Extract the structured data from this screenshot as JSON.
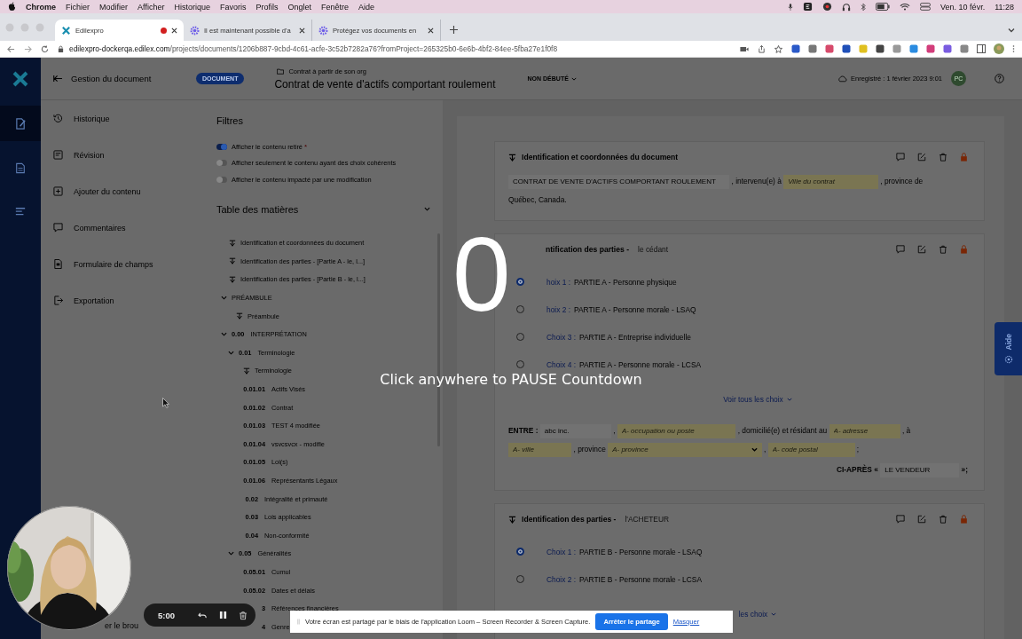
{
  "menu_bar": {
    "app": "Chrome",
    "items": [
      "Fichier",
      "Modifier",
      "Afficher",
      "Historique",
      "Favoris",
      "Profils",
      "Onglet",
      "Fenêtre",
      "Aide"
    ],
    "date": "Ven. 10 févr.",
    "time": "11:28"
  },
  "browser": {
    "tabs": [
      {
        "title": "Edilexpro",
        "selected": true,
        "recording": true
      },
      {
        "title": "Il est maintenant possible d'a",
        "selected": false,
        "recording": false
      },
      {
        "title": "Protégez vos documents en",
        "selected": false,
        "recording": false
      }
    ],
    "url_host": "edilexpro-dockerqa.edilex.com",
    "url_path": "/projects/documents/1206b887-9cbd-4c61-acfe-3c52b7282a76?fromProject=265325b0-6e6b-4bf2-84ee-5fba27e1f0f8"
  },
  "rail": [
    {
      "kind": "edit",
      "selected": true
    },
    {
      "kind": "document",
      "selected": false
    },
    {
      "kind": "list",
      "selected": false
    }
  ],
  "header": {
    "back_label": "Gestion du document",
    "badge": "DOCUMENT",
    "breadcrumb": "Contrat à partir de son org",
    "title": "Contrat de vente d'actifs comportant roulement",
    "status": "NON DÉBUTÉ",
    "saved": "Enregistré : 1 février 2023 9:01",
    "avatar": "PC"
  },
  "side_menu": [
    {
      "kind": "history",
      "label": "Historique"
    },
    {
      "kind": "revision",
      "label": "Révision"
    },
    {
      "kind": "add",
      "label": "Ajouter du contenu"
    },
    {
      "kind": "comments",
      "label": "Commentaires"
    },
    {
      "kind": "form",
      "label": "Formulaire de champs"
    },
    {
      "kind": "export",
      "label": "Exportation"
    }
  ],
  "side_menu_footer": "er le brou",
  "filters": {
    "title": "Filtres",
    "options": [
      {
        "label": "Afficher le contenu retiré",
        "on": true,
        "flag": "*"
      },
      {
        "label": "Afficher seulement le contenu ayant des choix cohérents",
        "on": false
      },
      {
        "label": "Afficher le contenu impacté par une modification",
        "on": false
      }
    ]
  },
  "toc": {
    "title": "Table des matières",
    "expanded": true,
    "items": [
      {
        "kind": "section",
        "label": "Identification et coordonnées du document"
      },
      {
        "kind": "section",
        "label": "Identification des parties - [Partie A - le, l...]"
      },
      {
        "kind": "section",
        "label": "Identification des parties - [Partie B - le, l...]"
      },
      {
        "kind": "heading",
        "label": "PRÉAMBULE",
        "expanded": true,
        "children": [
          {
            "kind": "section",
            "label": "Préambule"
          }
        ]
      },
      {
        "kind": "heading",
        "number": "0.00",
        "label": "INTERPRÉTATION",
        "expanded": true,
        "children": [
          {
            "kind": "heading",
            "number": "0.01",
            "label": "Terminologie",
            "expanded": true,
            "children": [
              {
                "kind": "section",
                "label": "Terminologie"
              },
              {
                "kind": "entry",
                "number": "0.01.01",
                "label": "Actifs Visés"
              },
              {
                "kind": "entry",
                "number": "0.01.02",
                "label": "Contrat"
              },
              {
                "kind": "entry",
                "number": "0.01.03",
                "label": "TEST 4 modifiée"
              },
              {
                "kind": "entry",
                "number": "0.01.04",
                "label": "vsvcsvcx - modifie"
              },
              {
                "kind": "entry",
                "number": "0.01.05",
                "label": "Loi(s)"
              },
              {
                "kind": "entry",
                "number": "0.01.06",
                "label": "Représentants Légaux"
              }
            ]
          },
          {
            "kind": "entry",
            "number": "0.02",
            "label": "Intégralité et primauté"
          },
          {
            "kind": "entry",
            "number": "0.03",
            "label": "Lois applicables"
          },
          {
            "kind": "entry",
            "number": "0.04",
            "label": "Non-conformité"
          },
          {
            "kind": "heading",
            "number": "0.05",
            "label": "Généralités",
            "expanded": true,
            "children": [
              {
                "kind": "entry",
                "number": "0.05.01",
                "label": "Cumul"
              },
              {
                "kind": "entry",
                "number": "0.05.02",
                "label": "Dates et délais"
              },
              {
                "kind": "entry",
                "number": "3",
                "label": "Références financières"
              },
              {
                "kind": "entry",
                "number": "4",
                "label": "Genre"
              }
            ]
          }
        ]
      }
    ]
  },
  "document": {
    "cards": [
      {
        "icon": true,
        "title": "Identification et coordonnées du document",
        "lines": [
          {
            "right": false,
            "segments": [
              {
                "kind": "value",
                "text": "CONTRAT DE VENTE D'ACTIFS COMPORTANT ROULEMENT"
              },
              {
                "kind": "text",
                "text": ", intervenu(e) à"
              },
              {
                "kind": "blank",
                "placeholder": "Ville du contrat"
              },
              {
                "kind": "text",
                "text": ", province de"
              },
              {
                "kind": "text",
                "text": "Québec, Canada."
              }
            ]
          }
        ]
      },
      {
        "icon": false,
        "title": "ntification des parties -",
        "subtitle": "le cédant",
        "choices": [
          {
            "label": "hoix 1 :",
            "text": "PARTIE A - Personne physique",
            "selected": true
          },
          {
            "label": "hoix 2 :",
            "text": "PARTIE A - Personne morale - LSAQ",
            "selected": false
          },
          {
            "label": "Choix 3 :",
            "text": "PARTIE A - Entreprise individuelle",
            "selected": false
          },
          {
            "label": "Choix 4 :",
            "text": "PARTIE A - Personne morale - LCSA",
            "selected": false
          }
        ],
        "more": "Voir tous les choix",
        "lines": [
          {
            "right": false,
            "segments": [
              {
                "kind": "label",
                "text": "ENTRE :"
              },
              {
                "kind": "value",
                "text": "abc inc."
              },
              {
                "kind": "text",
                "text": ","
              },
              {
                "kind": "blank",
                "placeholder": "A- occupation ou poste"
              },
              {
                "kind": "text",
                "text": ", domicilié(e) et résidant au"
              },
              {
                "kind": "blank",
                "placeholder": "A- adresse"
              },
              {
                "kind": "text",
                "text": ", à"
              },
              {
                "kind": "blank",
                "placeholder": "A- ville"
              },
              {
                "kind": "text",
                "text": ", province"
              },
              {
                "kind": "select",
                "placeholder": "A- province"
              },
              {
                "kind": "text",
                "text": ","
              },
              {
                "kind": "blank",
                "placeholder": "A- code postal"
              },
              {
                "kind": "text",
                "text": ";"
              }
            ]
          },
          {
            "right": true,
            "segments": [
              {
                "kind": "label",
                "text": "CI-APRÈS «"
              },
              {
                "kind": "value",
                "text": "LE VENDEUR"
              },
              {
                "kind": "label",
                "text": "»;"
              }
            ]
          }
        ]
      },
      {
        "icon": true,
        "title": "Identification des parties -",
        "subtitle": "l'ACHETEUR",
        "choices": [
          {
            "label": "Choix 1 :",
            "text": "PARTIE B - Personne morale - LSAQ",
            "selected": true
          },
          {
            "label": "Choix 2 :",
            "text": "PARTIE B - Personne morale - LCSA",
            "selected": false
          }
        ],
        "more": "les choix"
      }
    ]
  },
  "help_tab": "Aide",
  "countdown": {
    "number": "0",
    "hint": "Click anywhere to PAUSE Countdown"
  },
  "recorder": {
    "time": "5:00"
  },
  "share_notice": {
    "text": "Votre écran est partagé par le biais de l'application Loom – Screen Recorder & Screen Capture.",
    "stop": "Arrêter le partage",
    "hide": "Masquer"
  }
}
